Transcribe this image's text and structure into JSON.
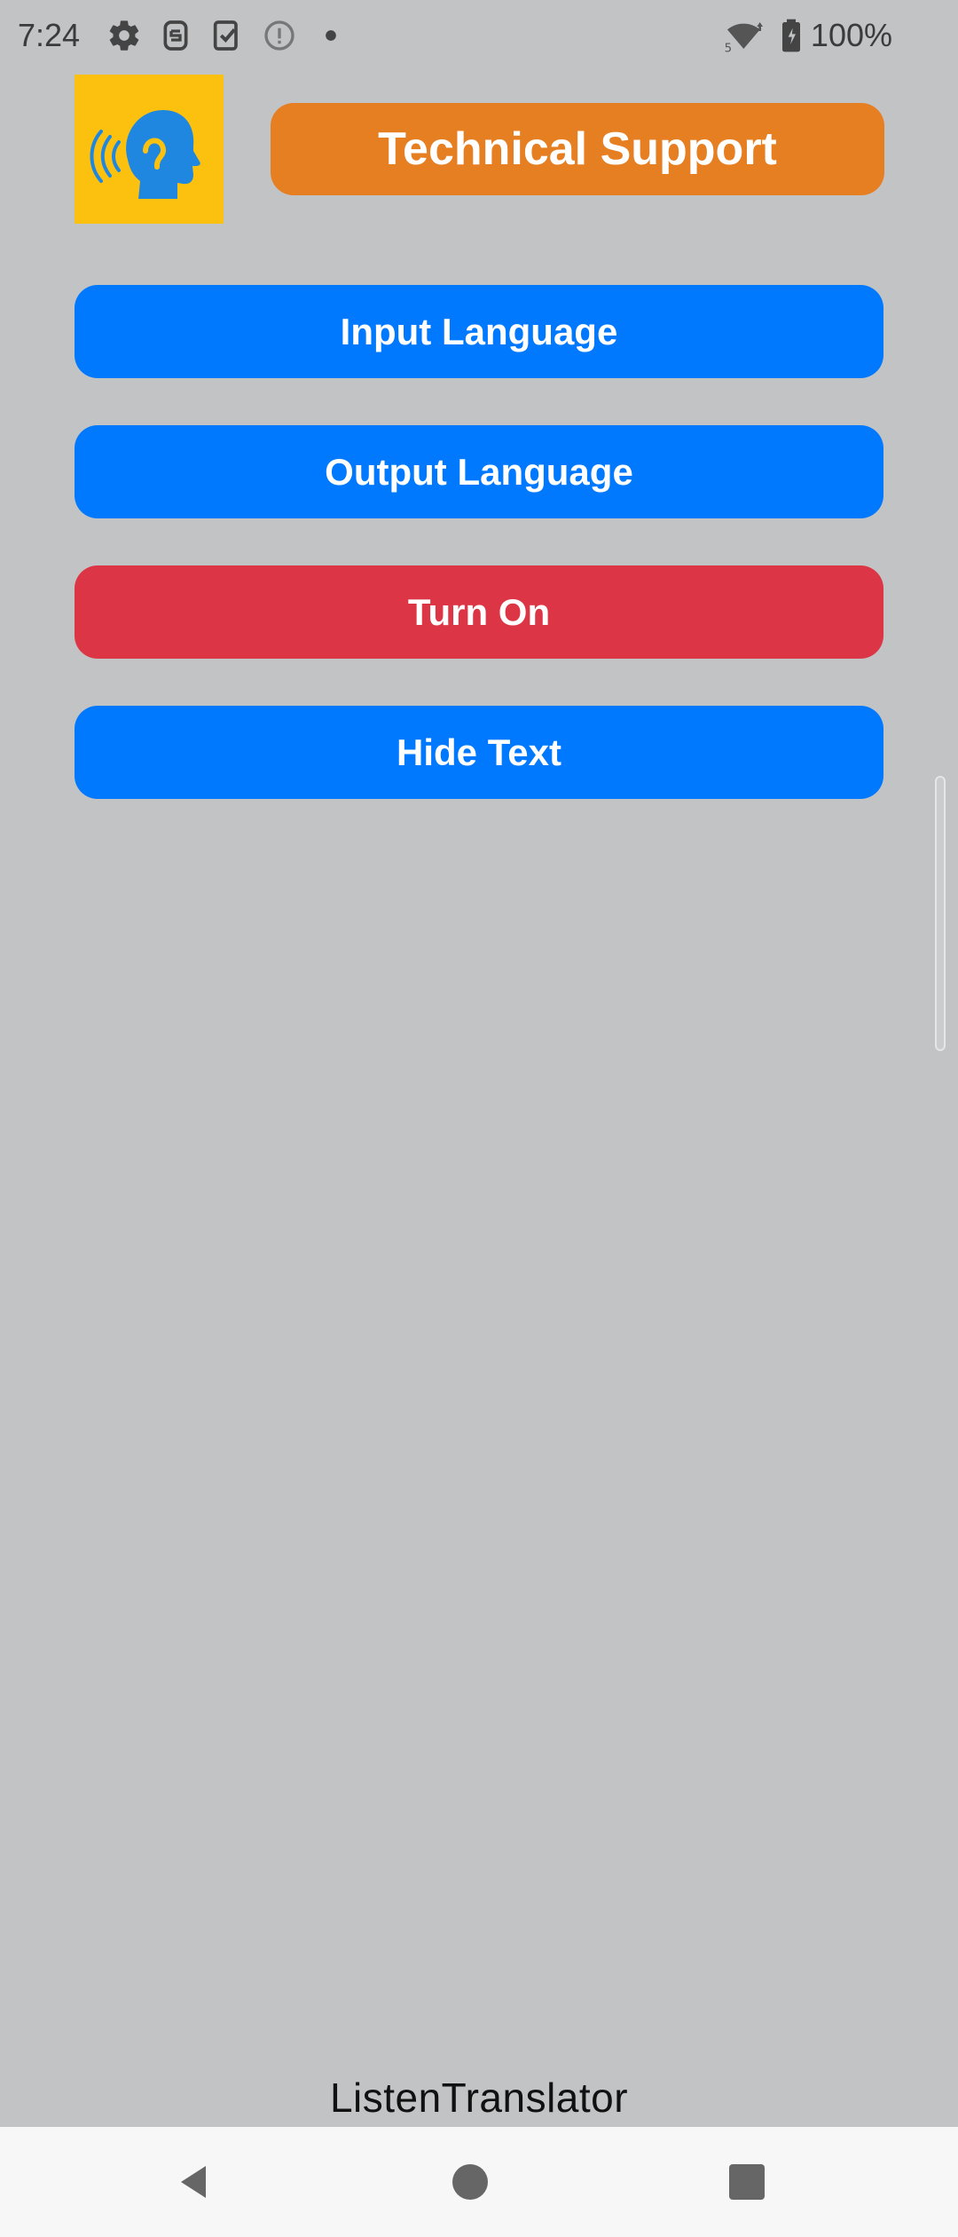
{
  "status_bar": {
    "time": "7:24",
    "battery_percent": "100%",
    "icons": [
      "gear-icon",
      "sim-icon",
      "clipboard-check-icon",
      "info-circle-icon",
      "dot-icon",
      "wifi-icon",
      "battery-icon"
    ]
  },
  "header": {
    "logo_icon": "listening-head-icon",
    "support_button_label": "Technical Support"
  },
  "main": {
    "input_language_label": "Input Language",
    "output_language_label": "Output Language",
    "turn_on_label": "Turn On",
    "hide_text_label": "Hide Text"
  },
  "footer": {
    "app_name": "ListenTranslator"
  },
  "nav_bar": {
    "icons": [
      "back-icon",
      "home-icon",
      "recents-icon"
    ]
  },
  "colors": {
    "background": "#c2c3c5",
    "logo_background": "#fcc10f",
    "logo_head": "#1f87e0",
    "support_button": "#e67e22",
    "primary_button": "#0079fe",
    "danger_button": "#dc3545",
    "nav_bar": "#f7f7f7"
  }
}
